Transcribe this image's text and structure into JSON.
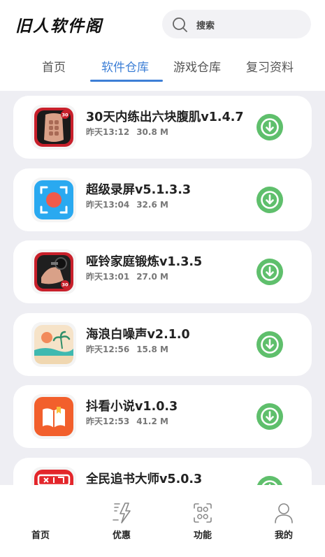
{
  "header": {
    "logo_text": "旧人软件阁",
    "search_placeholder": "搜索"
  },
  "tabs": [
    {
      "label": "首页",
      "active": false
    },
    {
      "label": "软件仓库",
      "active": true
    },
    {
      "label": "游戏仓库",
      "active": false
    },
    {
      "label": "复习资料",
      "active": false
    }
  ],
  "apps": [
    {
      "name": "30天内练出六块腹肌v1.4.7",
      "time": "昨天13:12",
      "size": "30.8 M",
      "icon": "fitness-abs-icon"
    },
    {
      "name": "超级录屏v5.1.3.3",
      "time": "昨天13:04",
      "size": "32.6 M",
      "icon": "screen-record-icon"
    },
    {
      "name": "哑铃家庭锻炼v1.3.5",
      "time": "昨天13:01",
      "size": "27.0 M",
      "icon": "dumbbell-workout-icon"
    },
    {
      "name": "海浪白噪声v2.1.0",
      "time": "昨天12:56",
      "size": "15.8 M",
      "icon": "beach-wave-icon"
    },
    {
      "name": "抖看小说v1.0.3",
      "time": "昨天12:53",
      "size": "41.2 M",
      "icon": "book-icon"
    },
    {
      "name": "全民追书大师v5.0.3",
      "time": "",
      "size": "",
      "icon": "novel-app-icon"
    }
  ],
  "bottom_nav": [
    {
      "label": "首页",
      "icon": "home-icon"
    },
    {
      "label": "优惠",
      "icon": "bolt-icon"
    },
    {
      "label": "功能",
      "icon": "apps-grid-icon"
    },
    {
      "label": "我的",
      "icon": "user-icon"
    }
  ],
  "colors": {
    "accent": "#3d7fd6",
    "download": "#5fbf6c",
    "background": "#eeeef3"
  }
}
